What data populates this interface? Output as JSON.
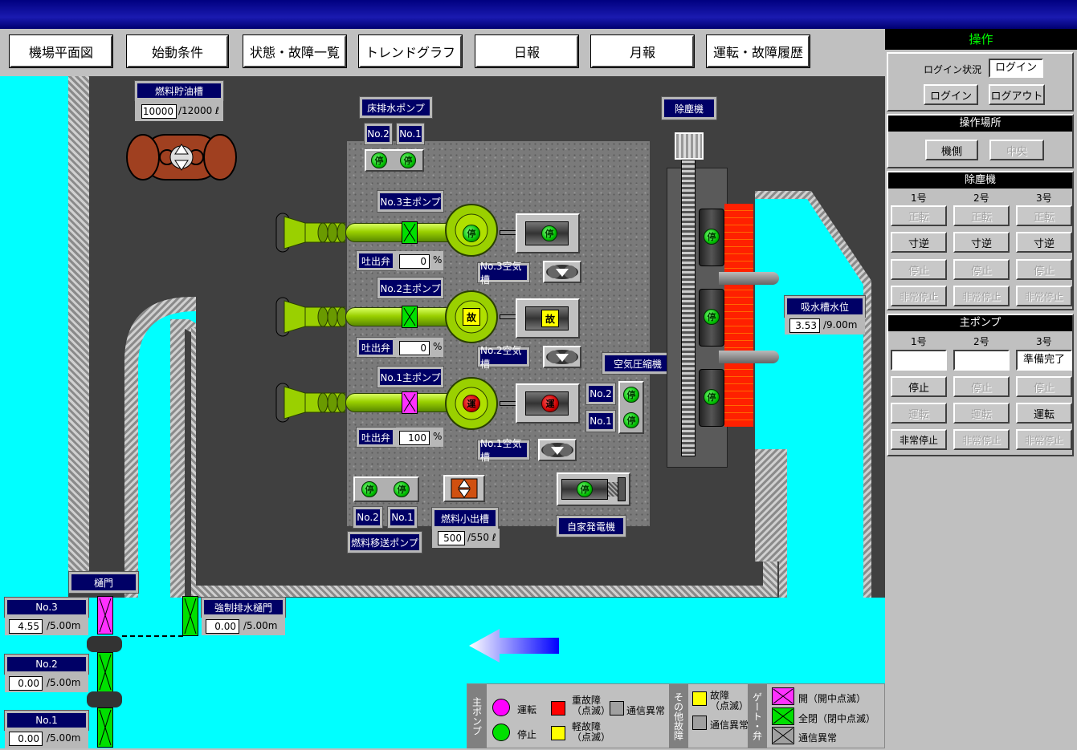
{
  "nav": [
    "機場平面図",
    "始動条件",
    "状態・故障一覧",
    "トレンドグラフ",
    "日報",
    "月報",
    "運転・故障履歴"
  ],
  "panel": {
    "title": "操作",
    "login_status_label": "ログイン状況",
    "login_status_value": "ログイン",
    "login_btn": "ログイン",
    "logout_btn": "ログアウト",
    "op_place_title": "操作場所",
    "op_place_local": "機側",
    "op_place_central": "中央",
    "dust_title": "除塵機",
    "dust_cols": [
      "1号",
      "2号",
      "3号"
    ],
    "dust_rows": [
      "正転",
      "寸逆",
      "停止",
      "非常停止"
    ],
    "pump_title": "主ポンプ",
    "pump_cols": [
      "1号",
      "2号",
      "3号"
    ],
    "pump_status": [
      "",
      "",
      "準備完了"
    ],
    "pump_row1": [
      "停止",
      "停止",
      "停止"
    ],
    "pump_row2": [
      "運転",
      "運転",
      "運転"
    ],
    "pump_row3": [
      "非常停止",
      "非常停止",
      "非常停止"
    ]
  },
  "fuel_tank": {
    "label": "燃料貯油槽",
    "value": "10000",
    "unit": "/12000 ℓ"
  },
  "floor_pump": {
    "label": "床排水ポンプ",
    "no2": "No.2",
    "no1": "No.1",
    "stop": "停"
  },
  "dust_remover_label": "除塵機",
  "main_pumps": [
    {
      "label": "No.3主ポンプ",
      "valve_label": "吐出弁",
      "valve_value": "0",
      "unit": "%",
      "tank_label": "No.3空気槽",
      "status": "停"
    },
    {
      "label": "No.2主ポンプ",
      "valve_label": "吐出弁",
      "valve_value": "0",
      "unit": "%",
      "tank_label": "No.2空気槽",
      "status": "故"
    },
    {
      "label": "No.1主ポンプ",
      "valve_label": "吐出弁",
      "valve_value": "100",
      "unit": "%",
      "tank_label": "No.1空気槽",
      "status": "運"
    }
  ],
  "compressor": {
    "label": "空気圧縮機",
    "no2": "No.2",
    "no1": "No.1"
  },
  "intake_level": {
    "label": "吸水槽水位",
    "value": "3.53",
    "unit": "/9.00m"
  },
  "fuel_transfer": {
    "label": "燃料移送ポンプ",
    "no2": "No.2",
    "no1": "No.1"
  },
  "fuel_small": {
    "label": "燃料小出槽",
    "value": "500",
    "unit": "/550 ℓ"
  },
  "generator": {
    "label": "自家発電機"
  },
  "gate": {
    "label": "樋門"
  },
  "gates": [
    {
      "label": "No.3",
      "value": "4.55",
      "unit": "/5.00m"
    },
    {
      "label": "No.2",
      "value": "0.00",
      "unit": "/5.00m"
    },
    {
      "label": "No.1",
      "value": "0.00",
      "unit": "/5.00m"
    }
  ],
  "forced_gate": {
    "label": "強制排水樋門",
    "value": "0.00",
    "unit": "/5.00m"
  },
  "legend": {
    "main_pump": "主ポンプ",
    "running": "運転",
    "stopped": "停止",
    "heavy_fault": "重故障\n（点滅）",
    "light_fault": "軽故障\n（点滅）",
    "comm_err": "通信異常",
    "other_fault": "その他故障",
    "fault": "故障\n（点滅）",
    "comm_err2": "通信異常",
    "gate_valve": "ゲート・弁",
    "open": "開（開中点滅）",
    "full_close": "全閉（閉中点滅）",
    "comm_err3": "通信異常"
  }
}
